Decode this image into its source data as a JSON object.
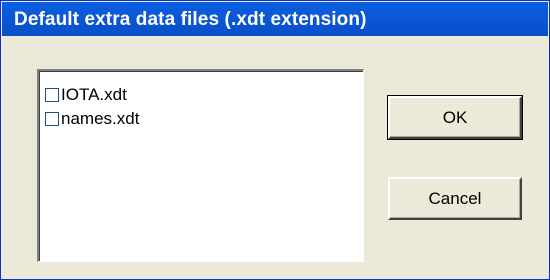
{
  "window": {
    "title": "Default extra data files (.xdt extension)"
  },
  "file_list": {
    "items": [
      {
        "label": "IOTA.xdt",
        "checked": false
      },
      {
        "label": "names.xdt",
        "checked": false
      }
    ]
  },
  "buttons": {
    "ok_label": "OK",
    "cancel_label": "Cancel"
  },
  "colors": {
    "titlebar": "#0a5fe0",
    "dialog_background": "#ece9d8"
  }
}
